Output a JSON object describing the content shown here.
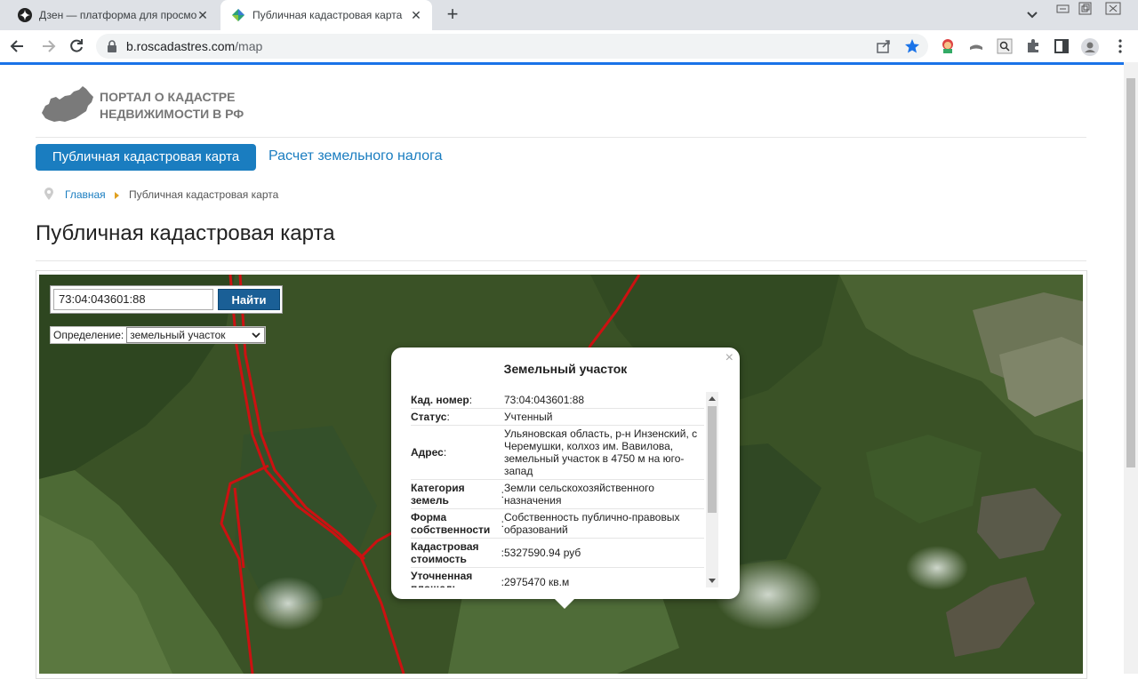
{
  "browser": {
    "tabs": [
      {
        "title": "Дзен — платформа для просмо",
        "active": false
      },
      {
        "title": "Публичная кадастровая карта",
        "active": true
      }
    ],
    "url_host": "b.roscadastres.com",
    "url_path": "/map"
  },
  "site": {
    "logo_line1": "ПОРТАЛ О КАДАСТРЕ",
    "logo_line2": "НЕДВИЖИМОСТИ В РФ"
  },
  "nav": {
    "active": "Публичная кадастровая карта",
    "link": "Расчет земельного налога"
  },
  "breadcrumb": {
    "home": "Главная",
    "current": "Публичная кадастровая карта"
  },
  "page": {
    "title": "Публичная кадастровая карта"
  },
  "map": {
    "search_value": "73:04:043601:88",
    "search_button": "Найти",
    "definition_label": "Определение:",
    "definition_value": "земельный участок"
  },
  "popup": {
    "title": "Земельный участок",
    "close": "×",
    "rows": [
      {
        "key": "Кад. номер",
        "value": "73:04:043601:88"
      },
      {
        "key": "Статус",
        "value": "Учтенный"
      },
      {
        "key": "Адрес",
        "value": "Ульяновская область, р-н Инзенский, с Черемушки, колхоз им. Вавилова, земельный участок в 4750 м на юго-запад"
      },
      {
        "key": "Категория земель",
        "value": "Земли сельскохозяйственного назначения"
      },
      {
        "key": "Форма собственности",
        "value": "Собственность публично-правовых образований"
      },
      {
        "key": "Кадастровая стоимость",
        "value": "5327590.94 руб"
      },
      {
        "key": "Уточненная площадь",
        "value": "2975470 кв.м"
      }
    ]
  },
  "colors": {
    "accent": "#1a7dc0",
    "button_dark": "#1a5f96",
    "parcel_line": "#d01010"
  }
}
